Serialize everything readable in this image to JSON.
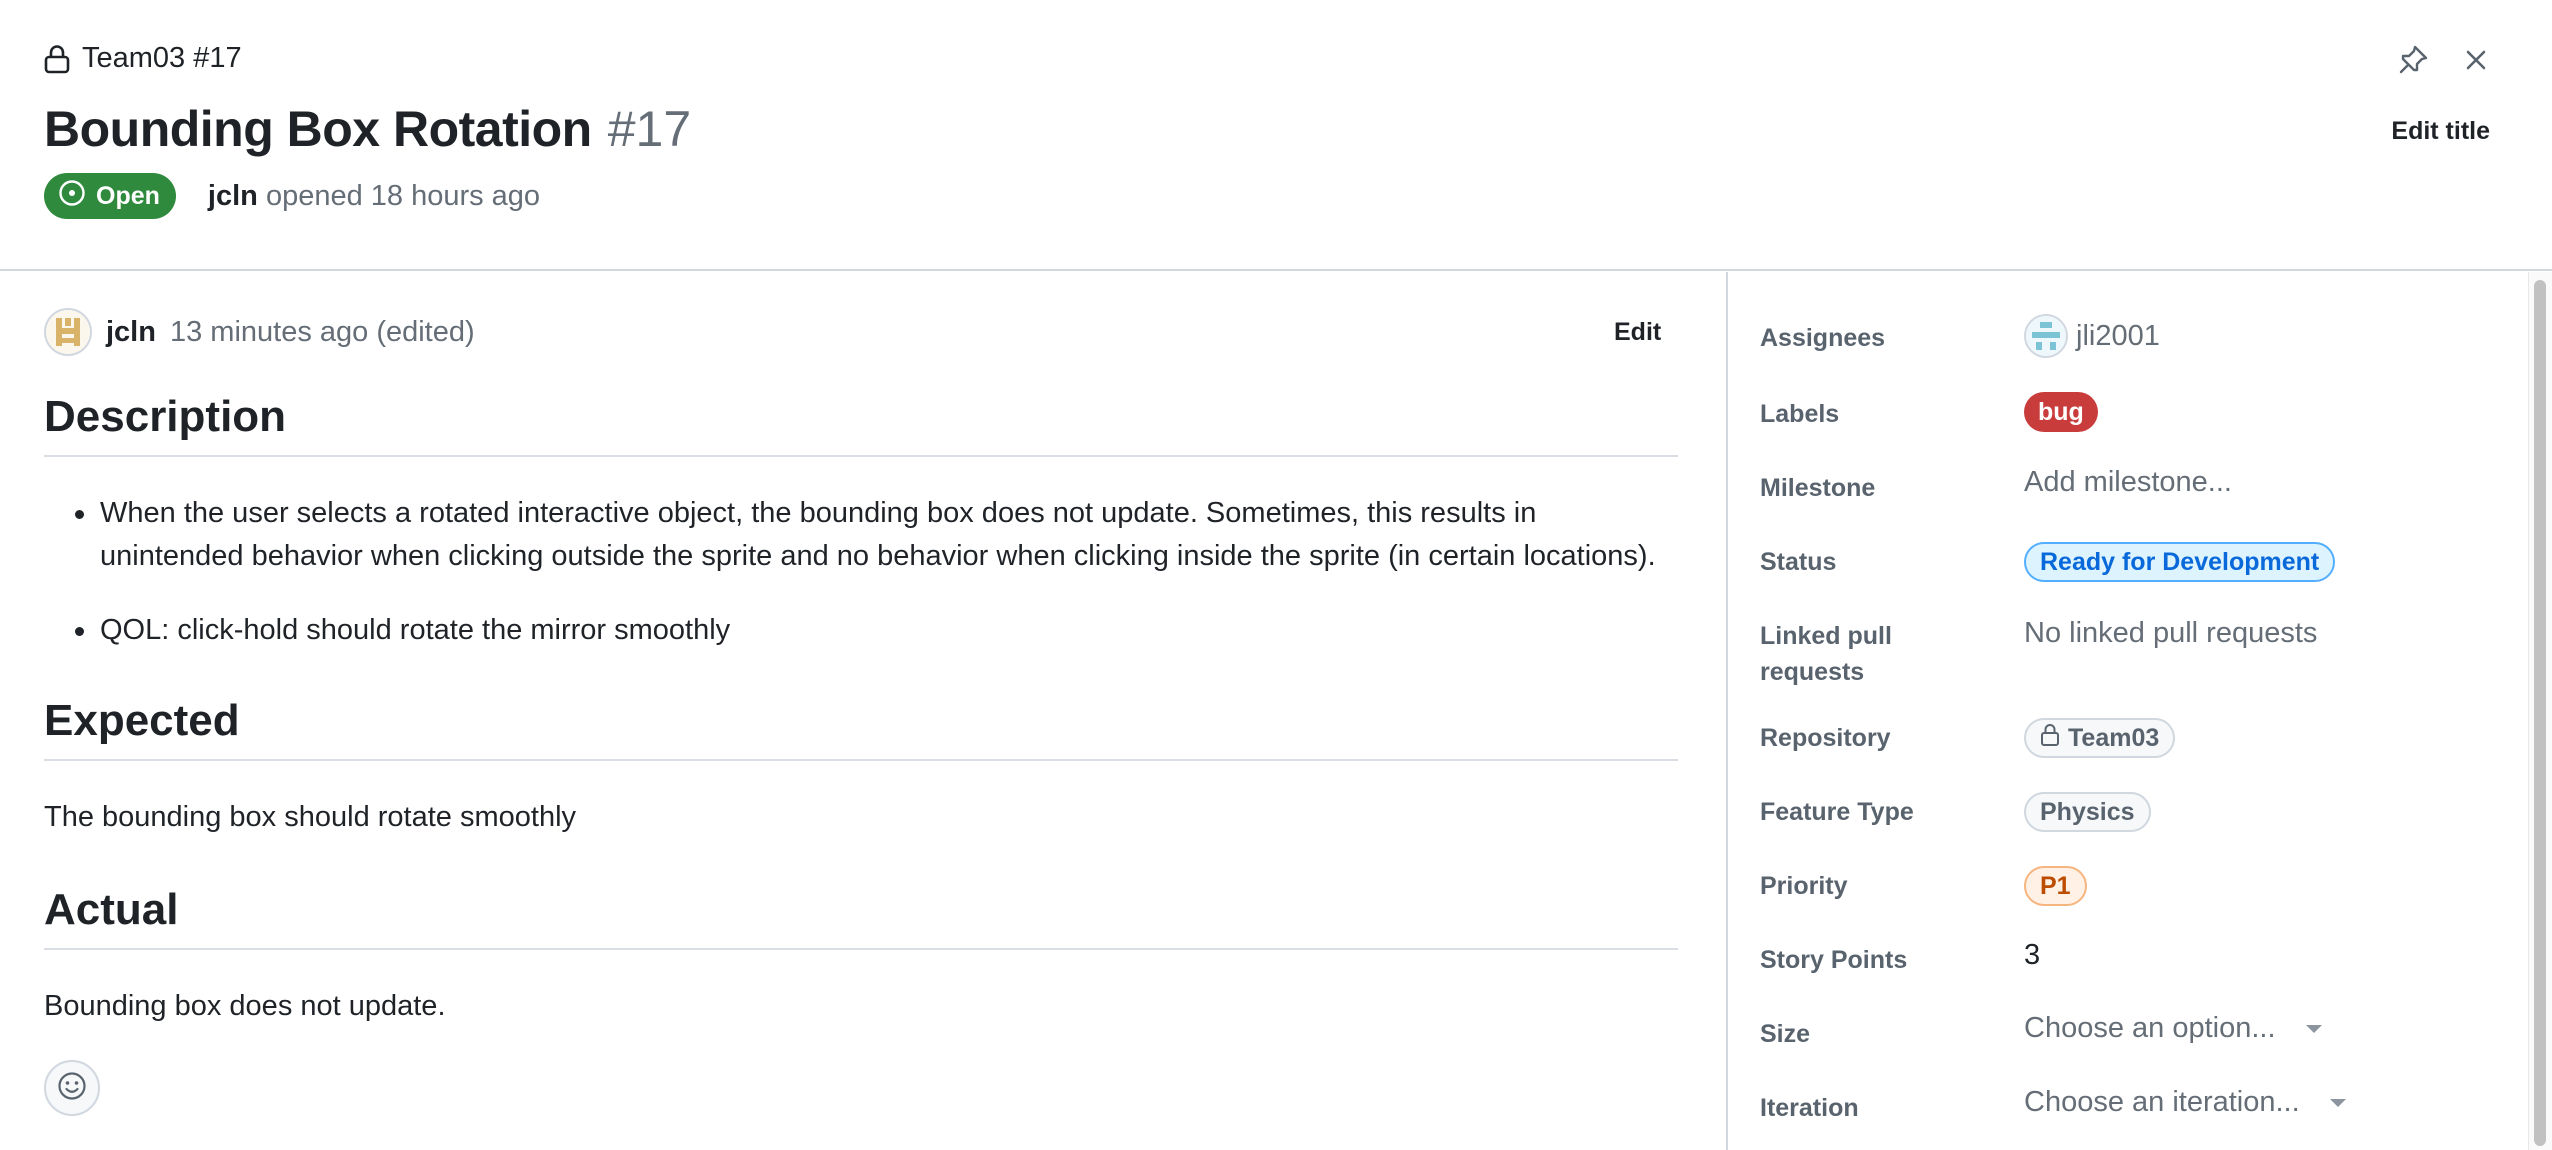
{
  "header": {
    "repo_crumb": "Team03 #17",
    "title": "Bounding Box Rotation",
    "issue_number": "#17",
    "state": "Open",
    "author": "jcln",
    "opened_text": "opened 18 hours ago",
    "edit_title_label": "Edit title",
    "icons": {
      "lock": "lock-icon",
      "pin": "pin-icon",
      "close": "close-icon",
      "issue_open": "issue-opened-icon"
    }
  },
  "comment": {
    "author": "jcln",
    "time": "13 minutes ago (edited)",
    "edit_label": "Edit",
    "sections": {
      "description": {
        "heading": "Description",
        "bullets": [
          "When the user selects a rotated interactive object, the bounding box does not update. Sometimes, this results in unintended behavior when clicking outside the sprite and no behavior when clicking inside the sprite (in certain locations).",
          "QOL: click-hold should rotate the mirror smoothly"
        ]
      },
      "expected": {
        "heading": "Expected",
        "text": "The bounding box should rotate smoothly"
      },
      "actual": {
        "heading": "Actual",
        "text": "Bounding box does not update."
      }
    },
    "reaction_icon": "smiley-icon"
  },
  "sidebar": {
    "assignees": {
      "label": "Assignees",
      "value": "jli2001"
    },
    "labels": {
      "label": "Labels",
      "value": "bug",
      "color": "#c93c3c"
    },
    "milestone": {
      "label": "Milestone",
      "value": "Add milestone..."
    },
    "status": {
      "label": "Status",
      "value": "Ready for Development",
      "color": "#0969da"
    },
    "linked_prs": {
      "label": "Linked pull requests",
      "value": "No linked pull requests"
    },
    "repository": {
      "label": "Repository",
      "value": "Team03"
    },
    "feature_type": {
      "label": "Feature Type",
      "value": "Physics"
    },
    "priority": {
      "label": "Priority",
      "value": "P1",
      "color": "#bc4c00"
    },
    "story_points": {
      "label": "Story Points",
      "value": "3"
    },
    "size": {
      "label": "Size",
      "value": "Choose an option..."
    },
    "iteration": {
      "label": "Iteration",
      "value": "Choose an iteration..."
    }
  },
  "colors": {
    "open_green": "#2f8a3e",
    "border": "#d0d7de",
    "muted": "#656d76"
  }
}
